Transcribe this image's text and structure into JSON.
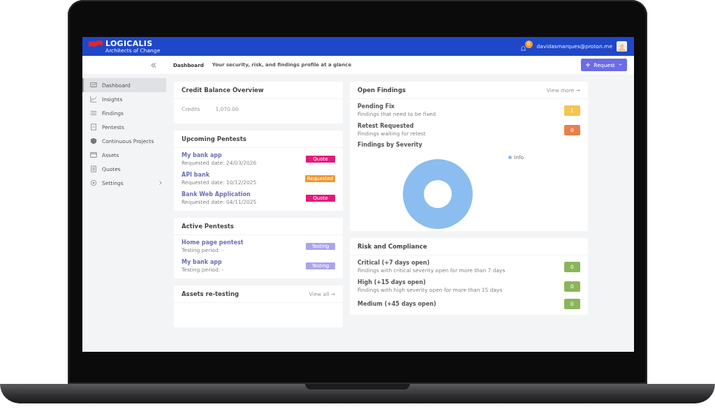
{
  "header": {
    "logo_name": "LOGICALIS",
    "logo_tagline": "Architects of Change",
    "notification_badge": "0",
    "user_email": "davidasmarques@proton.me"
  },
  "toolbar": {
    "page_title": "Dashboard",
    "page_subtitle": "Your security, risk, and findings profile at a glance",
    "request_button": "Request"
  },
  "sidebar": {
    "items": [
      {
        "label": "Dashboard",
        "selected": true,
        "expandable": false
      },
      {
        "label": "Insights",
        "selected": false,
        "expandable": false
      },
      {
        "label": "Findings",
        "selected": false,
        "expandable": false
      },
      {
        "label": "Pentests",
        "selected": false,
        "expandable": false
      },
      {
        "label": "Continuous Projects",
        "selected": false,
        "expandable": false
      },
      {
        "label": "Assets",
        "selected": false,
        "expandable": false
      },
      {
        "label": "Quotes",
        "selected": false,
        "expandable": false
      },
      {
        "label": "Settings",
        "selected": false,
        "expandable": true
      }
    ]
  },
  "credit_balance": {
    "title": "Credit Balance Overview",
    "label": "Credits",
    "value": "1,070.00"
  },
  "upcoming_pentests": {
    "title": "Upcoming Pentests",
    "items": [
      {
        "name": "My bank app",
        "detail": "Requested date: 24/03/2026",
        "status": "Quote",
        "color": "#e5197a"
      },
      {
        "name": "API bank",
        "detail": "Requested date: 10/12/2025",
        "status": "Requested",
        "color": "#f2962f"
      },
      {
        "name": "Bank Web Application",
        "detail": "Requested date: 04/11/2025",
        "status": "Quote",
        "color": "#e5197a"
      }
    ]
  },
  "active_pentests": {
    "title": "Active Pentests",
    "items": [
      {
        "name": "Home page pentest",
        "detail": "Testing period: -",
        "status": "Testing",
        "color": "#aaa4ee"
      },
      {
        "name": "My bank app",
        "detail": "Testing period: -",
        "status": "Testing",
        "color": "#aaa4ee"
      }
    ]
  },
  "assets_retesting": {
    "title": "Assets re-testing",
    "link": "View all →"
  },
  "open_findings": {
    "title": "Open Findings",
    "link": "View more →",
    "items": [
      {
        "name": "Pending Fix",
        "detail": "Findings that need to be fixed",
        "count": "1",
        "color": "#f5c451"
      },
      {
        "name": "Retest Requested",
        "detail": "Findings waiting for retest",
        "count": "0",
        "color": "#e8804a"
      }
    ],
    "severity_chart": {
      "title": "Findings by Severity",
      "legend": [
        {
          "label": "Info",
          "color": "#8bbdf0"
        }
      ]
    }
  },
  "risk_compliance": {
    "title": "Risk and Compliance",
    "items": [
      {
        "name": "Critical (+7 days open)",
        "detail": "Findings with critical severity open for more than 7 days",
        "count": "0",
        "color": "#8bb55a"
      },
      {
        "name": "High (+15 days open)",
        "detail": "Findings with high severity open for more than 15 days",
        "count": "0",
        "color": "#8bb55a"
      },
      {
        "name": "Medium (+45 days open)",
        "count": "0",
        "color": "#8bb55a"
      }
    ]
  }
}
